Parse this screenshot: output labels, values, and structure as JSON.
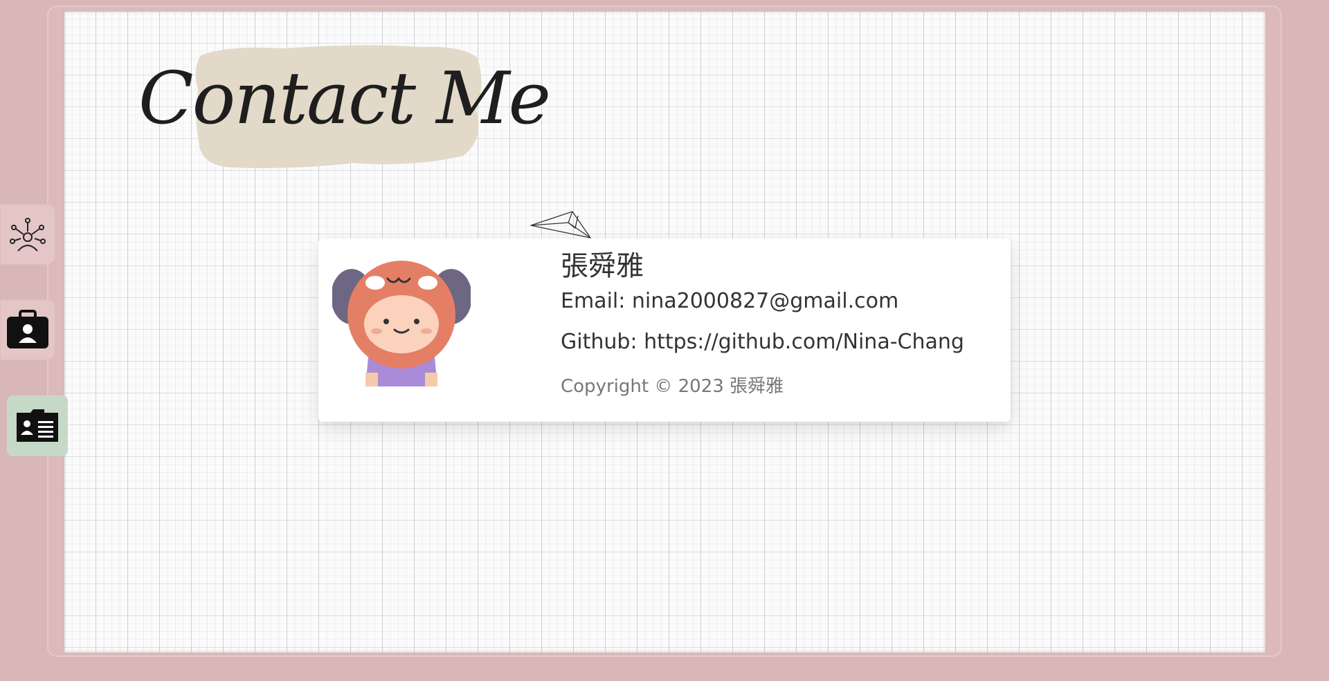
{
  "page": {
    "title": "Contact Me",
    "colors": {
      "background": "#d9b6b7",
      "title_splash": "#e3d9c8",
      "active_nav": "#c6d9c6",
      "inactive_nav": "#e4c6c7"
    }
  },
  "sidebar": {
    "items": [
      {
        "icon": "skills-network-icon",
        "state": "inactive"
      },
      {
        "icon": "briefcase-person-icon",
        "state": "inactive"
      },
      {
        "icon": "contact-card-icon",
        "state": "active"
      }
    ]
  },
  "contact": {
    "name": "張舜雅",
    "email_label": "Email: ",
    "email": "nina2000827@gmail.com",
    "github_label": "Github: ",
    "github": "https://github.com/Nina-Chang",
    "copyright": "Copyright © 2023 張舜雅",
    "avatar_icon": "avatar-illustration"
  }
}
